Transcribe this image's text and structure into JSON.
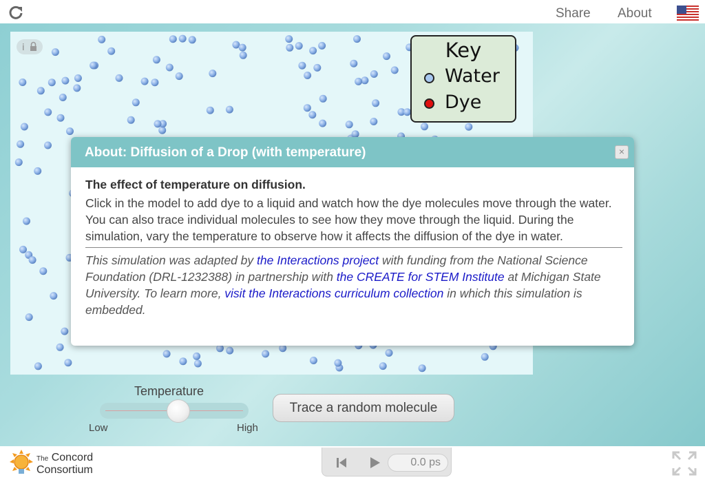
{
  "topbar": {
    "share_label": "Share",
    "about_label": "About",
    "reload_icon": "reload-icon",
    "language_icon": "us-flag-icon"
  },
  "key": {
    "title": "Key",
    "items": [
      {
        "label": "Water",
        "color": "#a8c8f0"
      },
      {
        "label": "Dye",
        "color": "#e01010"
      }
    ]
  },
  "dialog": {
    "title": "About: Diffusion of a Drop (with temperature)",
    "close_label": "×",
    "heading": "The effect of temperature on diffusion.",
    "description": "Click in the model to add dye to a liquid and watch how the dye molecules move through the water. You can also trace individual molecules to see how they move through the liquid. During the simulation, vary the temperature to observe how it affects the diffusion of the dye in water.",
    "credits": {
      "t1": "This simulation was adapted by ",
      "link1": "the Interactions project",
      "t2": " with funding from the National Science Foundation (DRL-1232388) in partnership with ",
      "link2": "the CREATE for STEM Institute",
      "t3": " at Michigan State University. To learn more, ",
      "link3": "visit the Interactions curriculum collection",
      "t4": " in which this simulation is embedded."
    }
  },
  "controls": {
    "temperature_label": "Temperature",
    "slider_min_label": "Low",
    "slider_max_label": "High",
    "temperature_level": 0.55,
    "trace_button_label": "Trace a random molecule"
  },
  "playback": {
    "time": "0.0 ps"
  },
  "logo": {
    "the": "The",
    "line1": "Concord",
    "line2": "Consortium"
  },
  "colors": {
    "accent": "#7ec4c6",
    "water_molecule": "#8fb4e8",
    "link": "#1a1ac8",
    "model_background": "#e4f7f9"
  }
}
